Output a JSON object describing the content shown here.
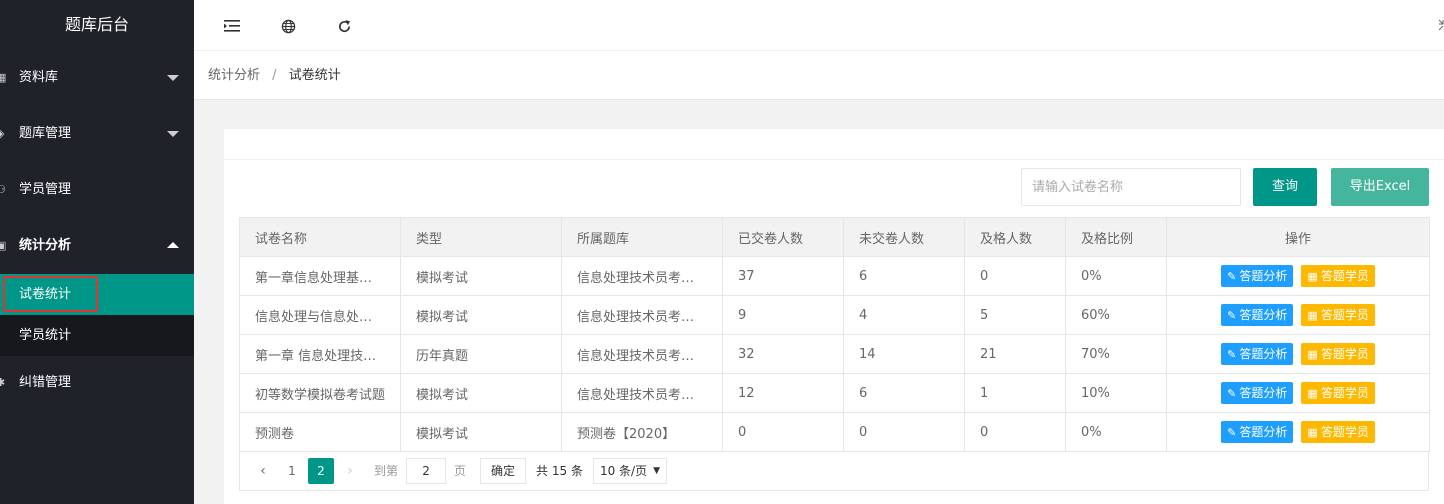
{
  "app": {
    "title": "题库后台"
  },
  "sidebar": {
    "items": [
      {
        "label": "资料库",
        "icon": "building-icon",
        "expandable": true,
        "expanded": false
      },
      {
        "label": "题库管理",
        "icon": "layers-icon",
        "expandable": true,
        "expanded": false
      },
      {
        "label": "学员管理",
        "icon": "user-icon",
        "expandable": false
      },
      {
        "label": "统计分析",
        "icon": "chart-icon",
        "expandable": true,
        "expanded": true
      },
      {
        "label": "纠错管理",
        "icon": "bug-icon",
        "expandable": false
      }
    ],
    "submenu": [
      {
        "label": "试卷统计",
        "active": true
      },
      {
        "label": "学员统计",
        "active": false
      }
    ]
  },
  "breadcrumb": {
    "parent": "统计分析",
    "separator": "/",
    "current": "试卷统计"
  },
  "toolbar": {
    "search_placeholder": "请输入试卷名称",
    "search_value": "",
    "query_label": "查询",
    "export_label": "导出Excel"
  },
  "table": {
    "columns": [
      "试卷名称",
      "类型",
      "所属题库",
      "已交卷人数",
      "未交卷人数",
      "及格人数",
      "及格比例",
      "操作"
    ],
    "rows": [
      {
        "name": "第一章信息处理基础知识",
        "type": "模拟考试",
        "bank": "信息处理技术员考试题库",
        "submitted": "37",
        "unsubmitted": "6",
        "passed": "0",
        "rate": "0%"
      },
      {
        "name": "信息处理与信息处理技术",
        "type": "模拟考试",
        "bank": "信息处理技术员考试题库",
        "submitted": "9",
        "unsubmitted": "4",
        "passed": "5",
        "rate": "60%"
      },
      {
        "name": "第一章 信息处理技术基础",
        "type": "历年真题",
        "bank": "信息处理技术员考试题库",
        "submitted": "32",
        "unsubmitted": "14",
        "passed": "21",
        "rate": "70%"
      },
      {
        "name": "初等数学模拟卷考试题",
        "type": "模拟考试",
        "bank": "信息处理技术员考试题库",
        "submitted": "12",
        "unsubmitted": "6",
        "passed": "1",
        "rate": "10%"
      },
      {
        "name": "预测卷",
        "type": "模拟考试",
        "bank": "预测卷【2020】",
        "submitted": "0",
        "unsubmitted": "0",
        "passed": "0",
        "rate": "0%"
      }
    ],
    "actions": {
      "analyze": "答题分析",
      "students": "答题学员"
    }
  },
  "pagination": {
    "pages": [
      "1",
      "2"
    ],
    "current": "2",
    "goto_prefix": "到第",
    "goto_value": "2",
    "goto_suffix": "页",
    "confirm": "确定",
    "total": "共 15 条",
    "page_size": "10 条/页"
  },
  "colors": {
    "sidebar_bg": "#20222a",
    "primary": "#009688",
    "export": "#46b59d",
    "blue": "#1e9fff",
    "yellow": "#ffb800",
    "highlight": "#e5322d"
  }
}
